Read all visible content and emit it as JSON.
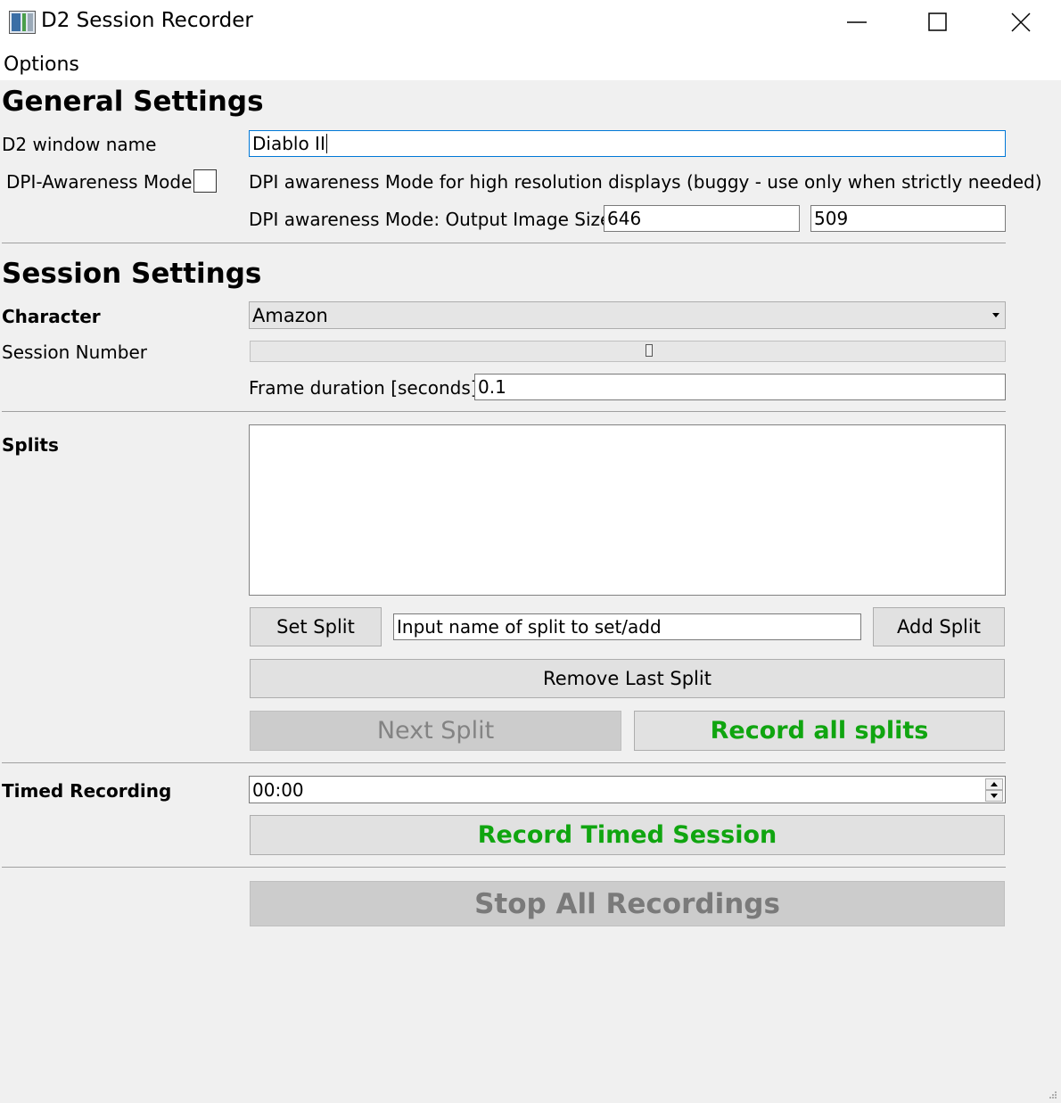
{
  "window": {
    "title": "D2 Session Recorder"
  },
  "menu": {
    "options": "Options"
  },
  "general": {
    "heading": "General Settings",
    "window_name_label": "D2 window name",
    "window_name_value": "Diablo II",
    "dpi_label": "DPI-Awareness Mode",
    "dpi_checked": false,
    "dpi_description": "DPI awareness Mode for high resolution displays (buggy - use only when strictly needed)",
    "output_size_label": "DPI awareness Mode: Output Image Size",
    "output_width": "646",
    "output_height": "509"
  },
  "session": {
    "heading": "Session Settings",
    "character_label": "Character",
    "character_value": "Amazon",
    "session_number_label": "Session Number",
    "session_number_value": "0",
    "frame_label": "Frame duration [seconds]",
    "frame_value": "0.1"
  },
  "splits": {
    "label": "Splits",
    "items": [],
    "set_split": "Set Split",
    "input_placeholder": "Input name of split to set/add",
    "add_split": "Add Split",
    "remove_last": "Remove Last Split",
    "next_split": "Next Split",
    "record_all": "Record all splits"
  },
  "timed": {
    "label": "Timed Recording",
    "time_value": "00:00",
    "record_button": "Record Timed Session"
  },
  "stop_button": "Stop All Recordings",
  "colors": {
    "green_text": "#10a510",
    "focus_border": "#0078d7"
  }
}
